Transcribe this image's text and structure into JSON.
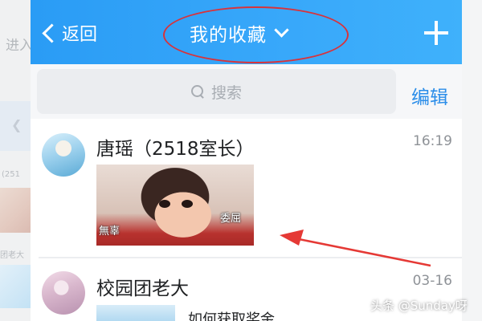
{
  "background": {
    "enter_text": "进入",
    "partial_number": "(251",
    "partial_name": "团老大"
  },
  "header": {
    "back_label": "返回",
    "title": "我的收藏",
    "colors": {
      "bar": "#2a9cf5",
      "highlight_ellipse": "#d8333b",
      "arrow": "#e53935"
    }
  },
  "search": {
    "placeholder": "搜索",
    "edit_label": "编辑"
  },
  "favorites": [
    {
      "name": "唐瑶（2518室长）",
      "time": "16:19",
      "content_type": "image",
      "image_caption_left": "無辜",
      "image_caption_right": "委屈"
    },
    {
      "name": "校园团老大",
      "time": "03-16",
      "content_type": "article",
      "article_title": "如何获取奖金"
    }
  ],
  "watermark": "头条 @Sunday呀"
}
